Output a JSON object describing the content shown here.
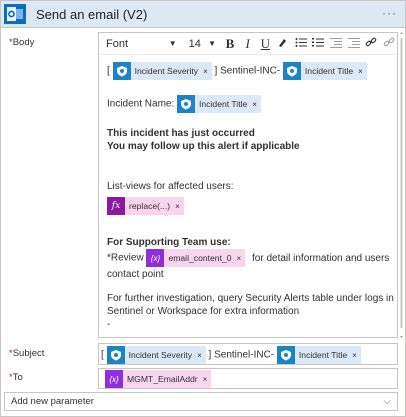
{
  "header": {
    "title": "Send an email (V2)",
    "more": "···"
  },
  "fields": {
    "body_label": "Body",
    "subject_label": "Subject",
    "to_label": "To",
    "required_mark": "*"
  },
  "toolbar": {
    "font": "Font",
    "size": "14",
    "bold": "B",
    "italic": "I",
    "underline": "U",
    "caret": "▼"
  },
  "body": {
    "line1_prefix": "[",
    "line1_mid": "] Sentinel-INC-",
    "token_severity": "Incident Severity",
    "token_title": "Incident Title",
    "incident_name_label": "Incident Name:",
    "alert_line1": "This incident has just occurred",
    "alert_line2": "You may follow up this alert if applicable",
    "listviews": "List-views for affected users:",
    "token_replace": "replace(...)",
    "fx_glyph": "fx",
    "support_heading": "For Supporting Team use:",
    "review_prefix": "*Review",
    "token_email": "email_content_0",
    "var_glyph": "{x}",
    "review_suffix": "for detail information and users",
    "contact": "contact point",
    "investigate1": "For further investigation, query Security Alerts table under logs in",
    "investigate2": "Sentinel or Workspace for extra information",
    "dash": "-"
  },
  "subject": {
    "prefix": "[",
    "mid": "] Sentinel-INC-",
    "token_severity": "Incident Severity",
    "token_title": "Incident Title"
  },
  "to": {
    "token": "MGMT_EmailAddr",
    "var_glyph": "{x}"
  },
  "add_param": {
    "label": "Add new parameter",
    "chevron": "⌵"
  },
  "token_close": "×"
}
